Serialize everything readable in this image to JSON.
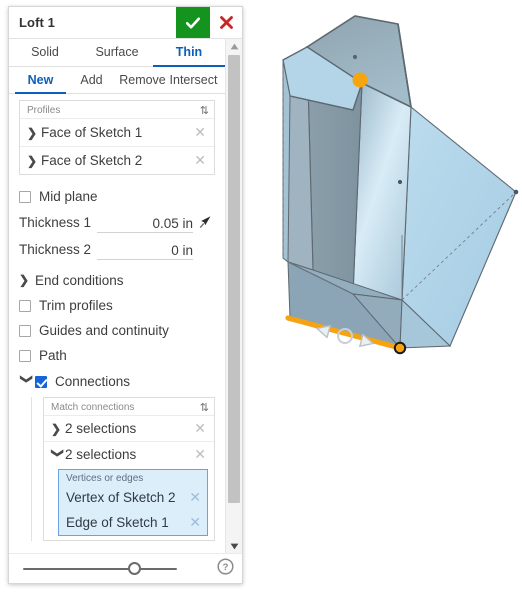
{
  "dialog": {
    "title": "Loft 1",
    "ok_label": "accept-checkmark",
    "cancel_label": "cancel-x",
    "primary_tabs": [
      {
        "label": "Solid",
        "active": false
      },
      {
        "label": "Surface",
        "active": false
      },
      {
        "label": "Thin",
        "active": true
      }
    ],
    "secondary_tabs": [
      {
        "label": "New",
        "active": true
      },
      {
        "label": "Add",
        "active": false
      },
      {
        "label": "Remove",
        "active": false
      },
      {
        "label": "Intersect",
        "active": false
      }
    ],
    "profiles": {
      "header": "Profiles",
      "sort_icon": "sort-updown-icon",
      "items": [
        {
          "label": "Face of Sketch 1"
        },
        {
          "label": "Face of Sketch 2"
        }
      ]
    },
    "mid_plane": {
      "label": "Mid plane",
      "checked": false
    },
    "thickness_1": {
      "label": "Thickness 1",
      "value": "0.05 in"
    },
    "thickness_2": {
      "label": "Thickness 2",
      "value": "0 in"
    },
    "end_conditions": {
      "label": "End conditions",
      "expanded": false
    },
    "trim_profiles": {
      "label": "Trim profiles",
      "checked": false
    },
    "guides_and_continuity": {
      "label": "Guides and continuity",
      "checked": false
    },
    "path": {
      "label": "Path",
      "checked": false
    },
    "connections": {
      "label": "Connections",
      "checked": true,
      "expanded": true
    },
    "match_connections": {
      "header": "Match connections",
      "sort_icon": "sort-updown-icon",
      "groups": [
        {
          "label": "2 selections",
          "expanded": false
        },
        {
          "label": "2 selections",
          "expanded": true
        }
      ]
    },
    "active_selection": {
      "header": "Vertices or edges",
      "items": [
        {
          "label": "Vertex of Sketch 2"
        },
        {
          "label": "Edge of Sketch 1"
        }
      ]
    },
    "footer": {
      "slider_value": 54,
      "help_label": "?"
    }
  },
  "colors": {
    "accent_blue": "#0b5fbd",
    "ok_green": "#14941e",
    "cancel_red": "#cc2222",
    "highlight_orange": "#f5a313",
    "checkbox_blue": "#1565d8",
    "face_light": "#afd2e8",
    "face_mid": "#93aebf",
    "face_dark": "#879daa",
    "edge_gray": "#5d6870",
    "selection_bg": "#ddeefb",
    "selection_border": "#6aa3dd"
  },
  "viewport": {
    "model_name": "lofted-solid-body",
    "highlighted_edge": "edge-of-sketch-1",
    "highlighted_vertex": "vertex-of-sketch-2",
    "manipulator_glyphs": [
      "arrow-left-triangle",
      "circle-handle",
      "arrow-right-triangle"
    ]
  }
}
